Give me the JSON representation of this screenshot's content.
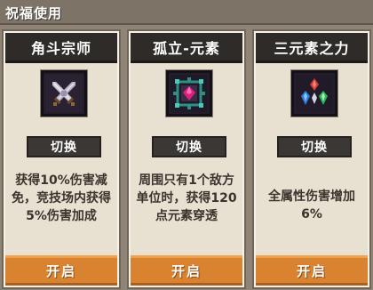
{
  "panel": {
    "title": "祝福使用"
  },
  "cards": [
    {
      "name": "角斗宗师",
      "icon": "crossed-swords-icon",
      "switch_label": "切换",
      "description": "获得10%伤害减免，竞技场内获得5%伤害加成",
      "action_label": "开启"
    },
    {
      "name": "孤立-元素",
      "icon": "isolated-element-gem-icon",
      "switch_label": "切换",
      "description": "周围只有1个敌方单位时，获得120点元素穿透",
      "action_label": "开启"
    },
    {
      "name": "三元素之力",
      "icon": "three-elements-crystals-icon",
      "switch_label": "切换",
      "description": "全属性伤害增加6%",
      "action_label": "开启"
    }
  ],
  "colors": {
    "card_bg": "#e8e1d2",
    "title_bar": "#2f2b28",
    "open_button": "#d9822f",
    "switch_button": "#3a3734"
  }
}
